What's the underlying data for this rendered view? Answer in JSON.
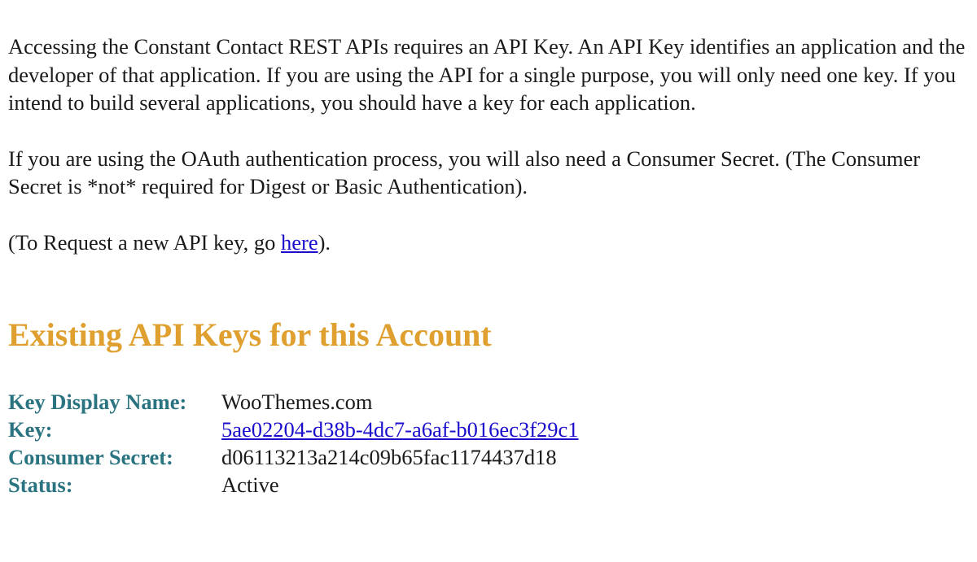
{
  "intro": {
    "p1": "Accessing the Constant Contact REST APIs requires an API Key. An API Key identifies an application and the developer of that application. If you are using the API for a single purpose, you will only need one key. If you intend to build several applications, you should have a key for each application.",
    "p2": "If you are using the OAuth authentication process, you will also need a Consumer Secret. (The Consumer Secret is *not* required for Digest or Basic Authentication).",
    "p3_prefix": "(To Request a new API key, go ",
    "p3_link": "here",
    "p3_suffix": ")."
  },
  "section": {
    "heading": "Existing API Keys for this Account"
  },
  "api_key": {
    "display_name_label": "Key Display Name:",
    "display_name_value": "WooThemes.com",
    "key_label": "Key:",
    "key_value": "5ae02204-d38b-4dc7-a6af-b016ec3f29c1",
    "secret_label": "Consumer Secret:",
    "secret_value": "d06113213a214c09b65fac1174437d18",
    "status_label": "Status:",
    "status_value": "Active"
  },
  "colors": {
    "heading": "#dfa02f",
    "label": "#2a7380",
    "link": "#1a0dcc",
    "text": "#1a1a1a"
  }
}
